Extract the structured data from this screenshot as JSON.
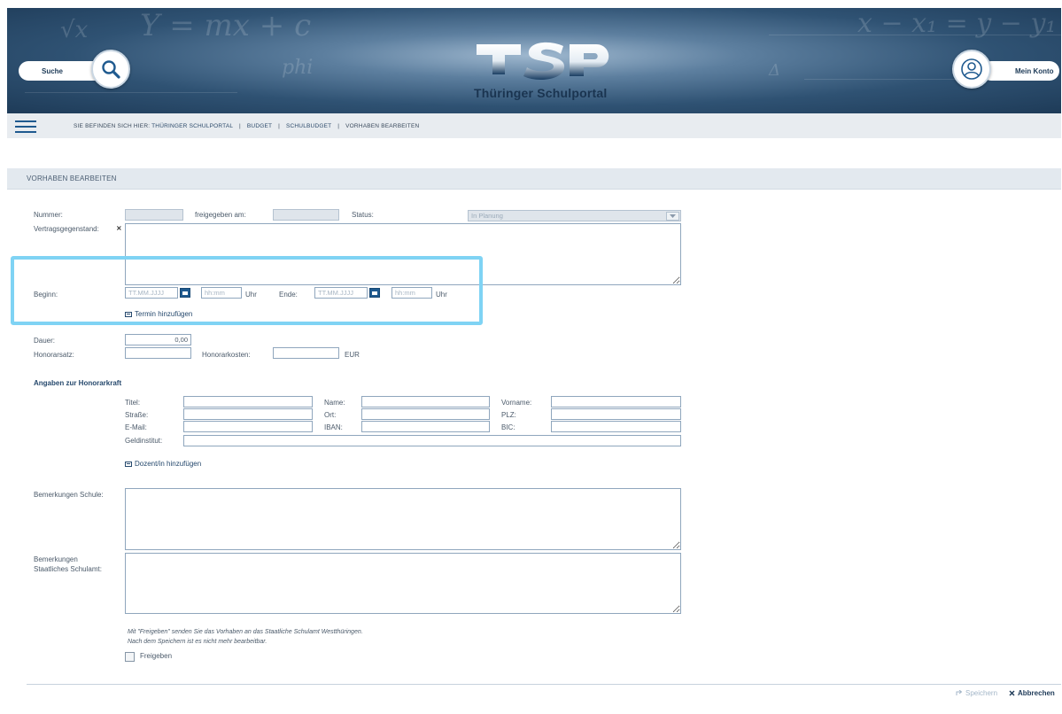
{
  "header": {
    "search_label": "Suche",
    "account_label": "Mein Konto",
    "logo_text": "TSP",
    "portal_name": "Thüringer Schulportal"
  },
  "breadcrumb": {
    "prefix": "SIE BEFINDEN SICH HIER:",
    "items": [
      "THÜRINGER SCHULPORTAL",
      "BUDGET",
      "SCHULBUDGET",
      "VORHABEN BEARBEITEN"
    ],
    "separator": "|"
  },
  "panel": {
    "title": "VORHABEN BEARBEITEN"
  },
  "form": {
    "nummer_label": "Nummer:",
    "freigegeben_label": "freigegeben am:",
    "status_label": "Status:",
    "status_value": "In Planung",
    "vertrag_label": "Vertragsgegenstand:",
    "required_mark": "×",
    "beginn_label": "Beginn:",
    "ende_label": "Ende:",
    "date_placeholder": "TT.MM.JJJJ",
    "time_placeholder": "hh:mm",
    "uhr_label": "Uhr",
    "add_termin": "Termin hinzufügen",
    "dauer_label": "Dauer:",
    "dauer_value": "0,00",
    "honorarsatz_label": "Honorarsatz:",
    "honorarkosten_label": "Honorarkosten:",
    "currency": "EUR"
  },
  "honorarkraft": {
    "heading": "Angaben zur Honorarkraft",
    "titel": "Titel:",
    "name": "Name:",
    "vorname": "Vorname:",
    "strasse": "Straße:",
    "ort": "Ort:",
    "plz": "PLZ:",
    "email": "E-Mail:",
    "iban": "IBAN:",
    "bic": "BIC:",
    "geldinstitut": "Geldinstitut:",
    "add_dozent": "Dozent/in hinzufügen"
  },
  "remarks": {
    "schule_label": "Bemerkungen Schule:",
    "schulamt_label_1": "Bemerkungen",
    "schulamt_label_2": "Staatliches Schulamt:"
  },
  "release": {
    "note_1": "Mit \"Freigeben\" senden Sie das Vorhaben an das Staatliche Schulamt Westthüringen.",
    "note_2": "Nach dem Speichern ist es nicht mehr bearbeitbar.",
    "checkbox_label": "Freigeben"
  },
  "footer": {
    "save_label": "Speichern",
    "cancel_label": "Abbrechen"
  },
  "colors": {
    "primary": "#1f5a8f",
    "highlight": "#7fd3f4",
    "banner_dark": "#1e3b58"
  }
}
